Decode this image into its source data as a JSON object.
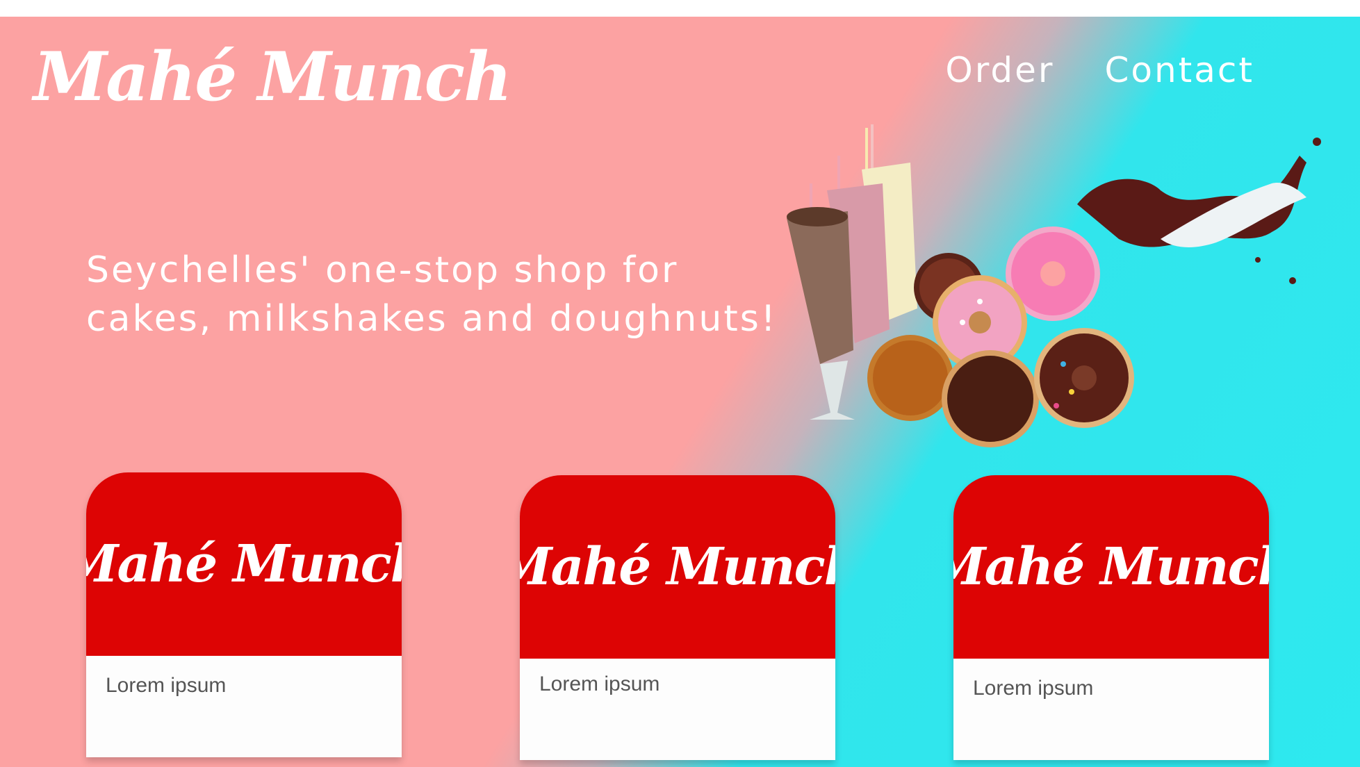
{
  "brand": {
    "logo_text": "Mahé Munch"
  },
  "nav": {
    "items": [
      "Order",
      "Contact"
    ]
  },
  "hero": {
    "tagline_line1": "Seychelles' one-stop shop for",
    "tagline_line2": "cakes, milkshakes and doughnuts!",
    "image_icon": "milkshakes-and-doughnuts-illustration"
  },
  "cards": [
    {
      "logo_text": "Mahé Munch",
      "text": "Lorem ipsum"
    },
    {
      "logo_text": "Mahé Munch",
      "text": "Lorem ipsum"
    },
    {
      "logo_text": "Mahé Munch",
      "text": "Lorem ipsum"
    }
  ],
  "colors": {
    "gradient_left": "#fca2a2",
    "gradient_right": "#2ee9ef",
    "card_red": "#dd0404",
    "text_white": "#ffffff"
  }
}
